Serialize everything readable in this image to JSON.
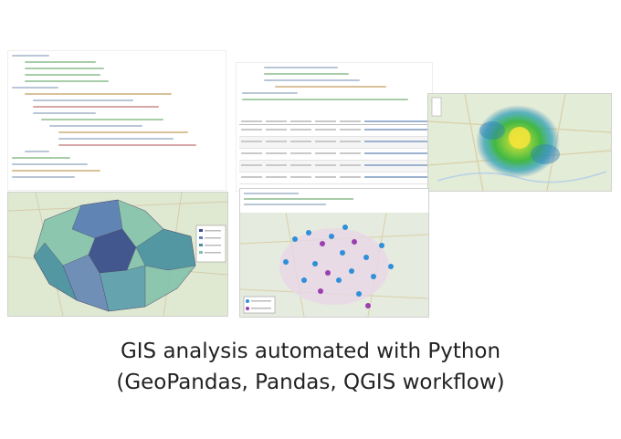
{
  "caption": {
    "line1": "GIS analysis automated with Python",
    "line2": "(GeoPandas, Pandas, QGIS workflow)"
  },
  "colors": {
    "choropleth_light": "#7fc1a9",
    "choropleth_mid": "#4a8fa0",
    "choropleth_dark": "#3c4b8c",
    "heatmap_core": "#f2e33a",
    "heatmap_mid": "#42b843",
    "heatmap_outer": "#2c7fb8",
    "marker_blue": "#2f8fd8",
    "marker_purple": "#9b3fb0",
    "map_base": "#dfe9d2",
    "code_text": "#b9c6d6"
  },
  "icons": [
    "map-marker-icon",
    "code-editor-icon",
    "data-table-icon"
  ]
}
